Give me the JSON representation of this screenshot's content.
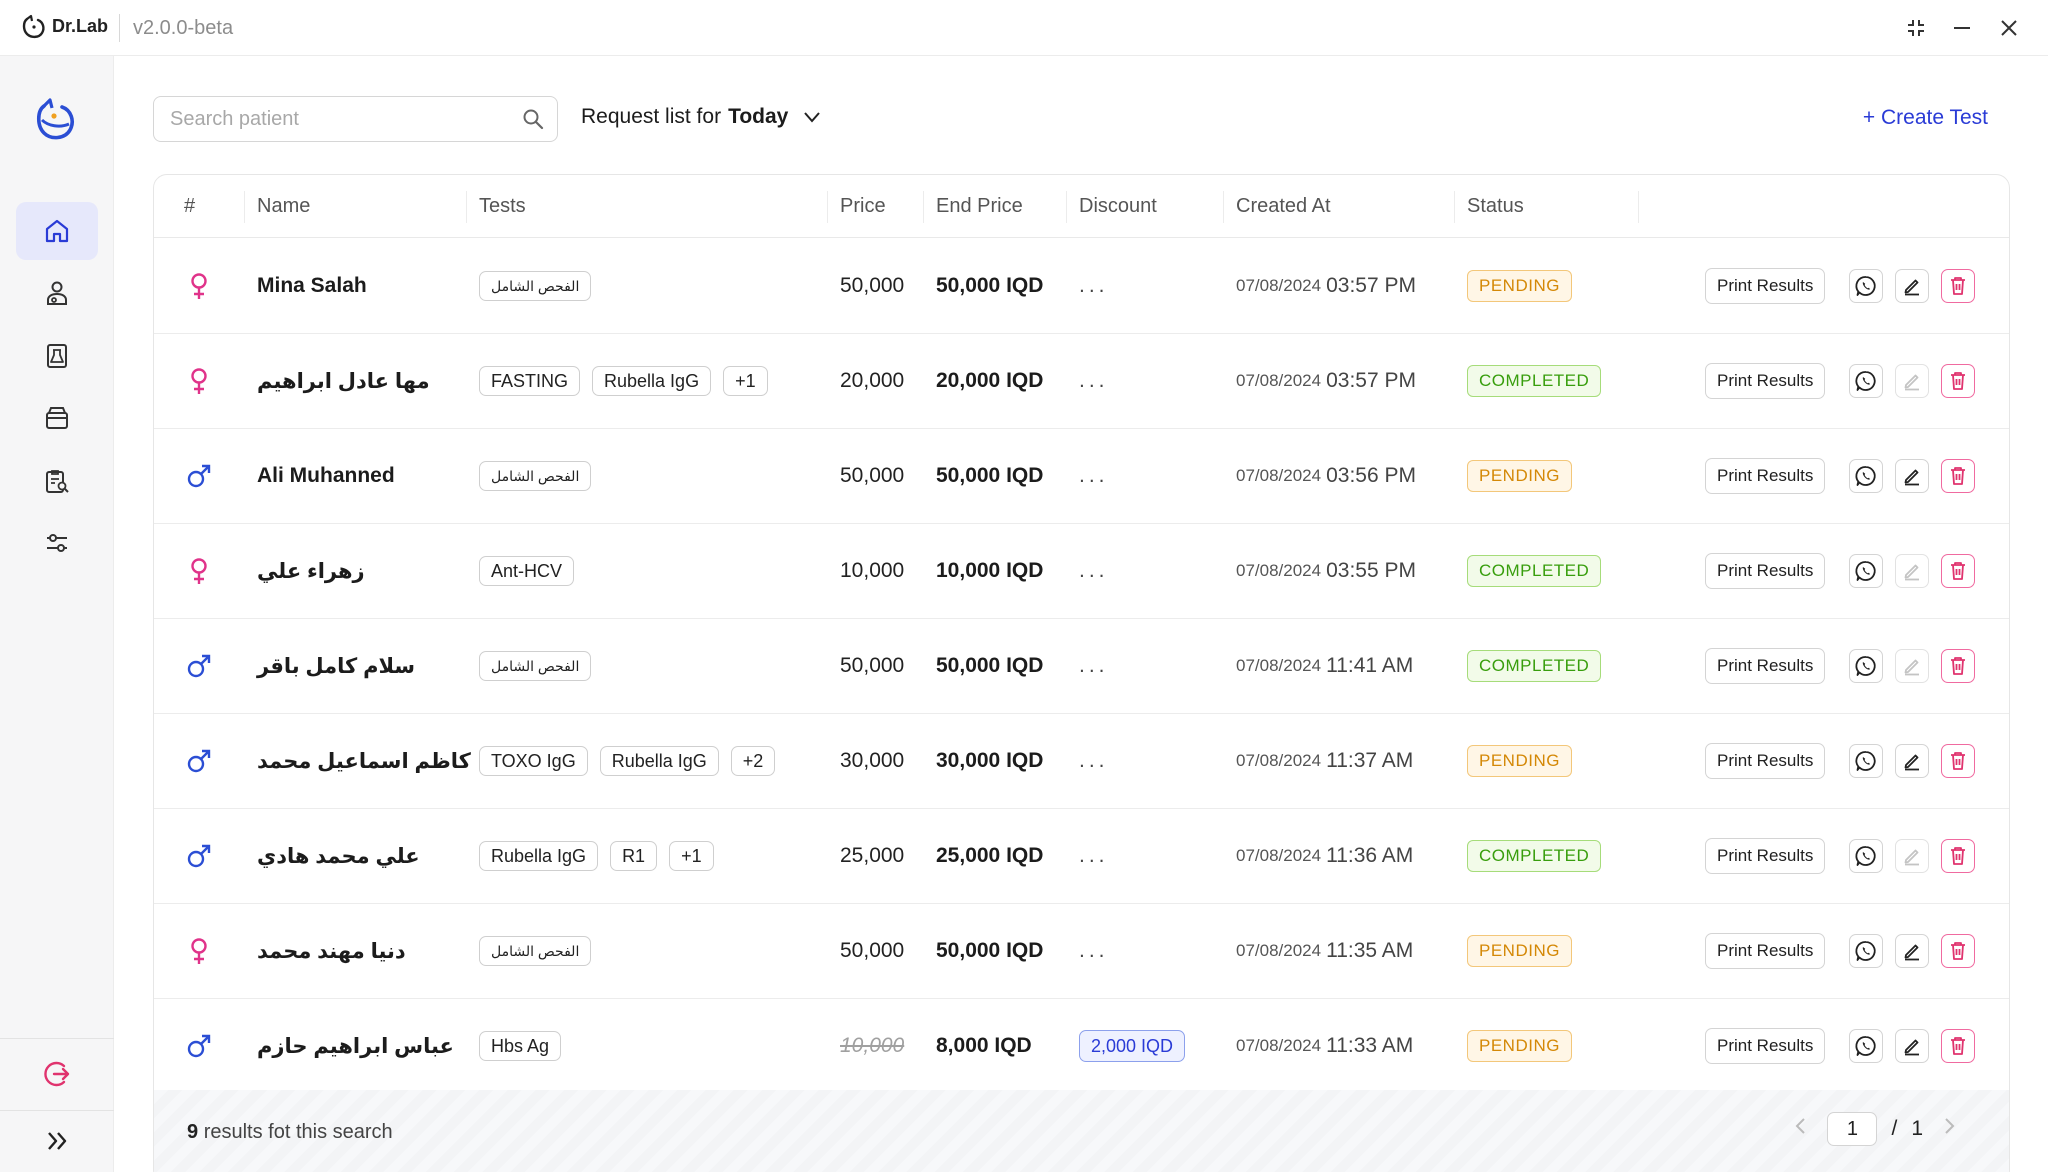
{
  "titlebar": {
    "brand": "Dr.Lab",
    "version": "v2.0.0-beta"
  },
  "toolbar": {
    "search_placeholder": "Search patient",
    "request_prefix": "Request list for",
    "request_period": "Today",
    "create_label": "+ Create Test"
  },
  "table": {
    "headers": {
      "index": "#",
      "name": "Name",
      "tests": "Tests",
      "price": "Price",
      "end_price": "End Price",
      "discount": "Discount",
      "created_at": "Created At",
      "status": "Status"
    },
    "print_label": "Print Results",
    "rows": [
      {
        "gender": "female",
        "name": "Mina Salah",
        "tests": [
          "الفحص الشامل"
        ],
        "price": "50,000",
        "end_price": "50,000 IQD",
        "discount": "...",
        "date": "07/08/2024",
        "time": "03:57 PM",
        "status": "PENDING"
      },
      {
        "gender": "female",
        "name": "مها عادل ابراهيم",
        "tests": [
          "FASTING",
          "Rubella IgG",
          "+1"
        ],
        "price": "20,000",
        "end_price": "20,000 IQD",
        "discount": "...",
        "date": "07/08/2024",
        "time": "03:57 PM",
        "status": "COMPLETED"
      },
      {
        "gender": "male",
        "name": "Ali Muhanned",
        "tests": [
          "الفحص الشامل"
        ],
        "price": "50,000",
        "end_price": "50,000 IQD",
        "discount": "...",
        "date": "07/08/2024",
        "time": "03:56 PM",
        "status": "PENDING"
      },
      {
        "gender": "female",
        "name": "زهراء علي",
        "tests": [
          "Ant-HCV"
        ],
        "price": "10,000",
        "end_price": "10,000 IQD",
        "discount": "...",
        "date": "07/08/2024",
        "time": "03:55 PM",
        "status": "COMPLETED"
      },
      {
        "gender": "male",
        "name": "سلام كامل باقر",
        "tests": [
          "الفحص الشامل"
        ],
        "price": "50,000",
        "end_price": "50,000 IQD",
        "discount": "...",
        "date": "07/08/2024",
        "time": "11:41 AM",
        "status": "COMPLETED"
      },
      {
        "gender": "male",
        "name": "كاظم اسماعيل محمد",
        "tests": [
          "TOXO IgG",
          "Rubella IgG",
          "+2"
        ],
        "price": "30,000",
        "end_price": "30,000 IQD",
        "discount": "...",
        "date": "07/08/2024",
        "time": "11:37 AM",
        "status": "PENDING"
      },
      {
        "gender": "male",
        "name": "علي محمد هادي",
        "tests": [
          "Rubella IgG",
          "R1",
          "+1"
        ],
        "price": "25,000",
        "end_price": "25,000 IQD",
        "discount": "...",
        "date": "07/08/2024",
        "time": "11:36 AM",
        "status": "COMPLETED"
      },
      {
        "gender": "female",
        "name": "دنيا مهند محمد",
        "tests": [
          "الفحص الشامل"
        ],
        "price": "50,000",
        "end_price": "50,000 IQD",
        "discount": "...",
        "date": "07/08/2024",
        "time": "11:35 AM",
        "status": "PENDING"
      },
      {
        "gender": "male",
        "name": "عباس ابراهيم حازم",
        "tests": [
          "Hbs Ag"
        ],
        "price": "10,000",
        "price_struck": true,
        "end_price": "8,000 IQD",
        "discount": "2,000 IQD",
        "date": "07/08/2024",
        "time": "11:33 AM",
        "status": "PENDING"
      }
    ]
  },
  "footer": {
    "count": "9",
    "results_text": "results fot this search",
    "page_current": "1",
    "page_sep": "/",
    "page_total": "1"
  },
  "colors": {
    "accent": "#2a3bd6",
    "female": "#e0338a",
    "male": "#2b4ed4",
    "pending": "#d48806",
    "completed": "#389e0d",
    "danger": "#e0336e"
  }
}
